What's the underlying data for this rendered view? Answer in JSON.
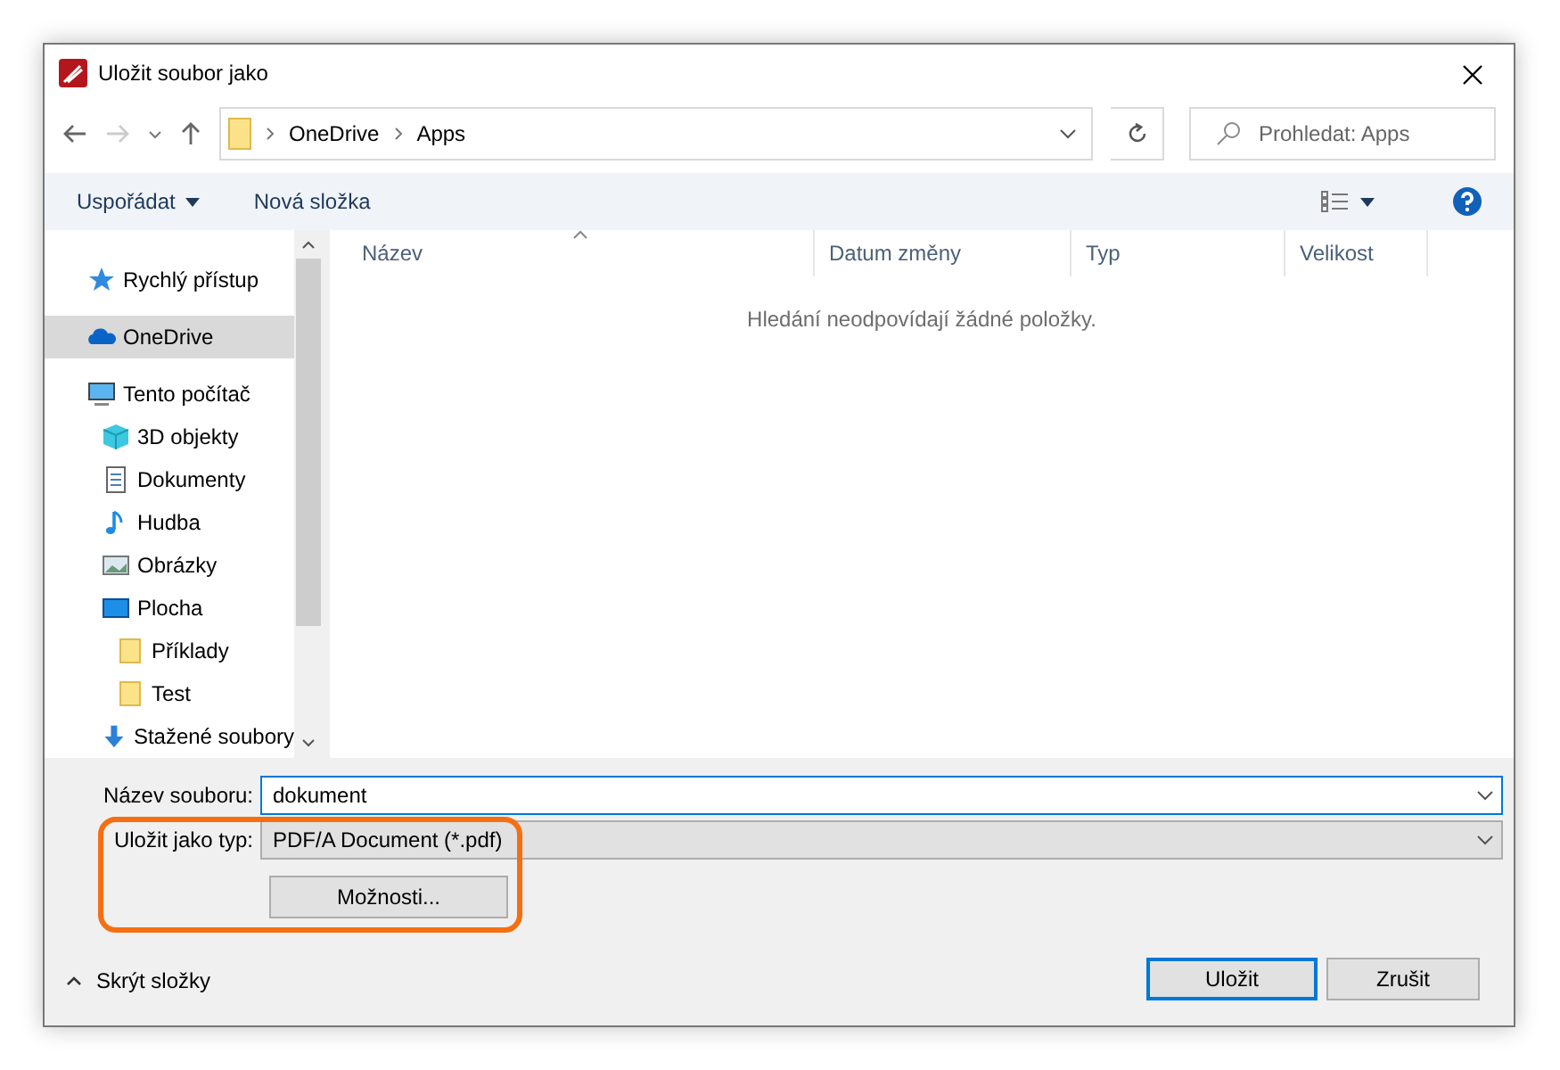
{
  "window": {
    "title": "Uložit soubor jako"
  },
  "address": {
    "path": [
      "OneDrive",
      "Apps"
    ],
    "search_placeholder": "Prohledat: Apps"
  },
  "toolbar": {
    "organize": "Uspořádat",
    "new_folder": "Nová složka"
  },
  "sidebar": {
    "items": [
      {
        "label": "Rychlý přístup",
        "kind": "star",
        "selected": false
      },
      {
        "label": "OneDrive",
        "kind": "cloud",
        "selected": true
      },
      {
        "label": "Tento počítač",
        "kind": "computer",
        "selected": false,
        "children": [
          {
            "label": "3D objekty",
            "kind": "cube",
            "selected": false
          },
          {
            "label": "Dokumenty",
            "kind": "document",
            "selected": false
          },
          {
            "label": "Hudba",
            "kind": "music",
            "selected": false
          },
          {
            "label": "Obrázky",
            "kind": "image",
            "selected": false
          },
          {
            "label": "Plocha",
            "kind": "desktop",
            "selected": false,
            "children": [
              {
                "label": "Příklady",
                "kind": "folder",
                "selected": false
              },
              {
                "label": "Test",
                "kind": "folder",
                "selected": false
              }
            ]
          },
          {
            "label": "Stažené soubory",
            "kind": "download",
            "selected": false
          }
        ]
      }
    ]
  },
  "file_list": {
    "columns": [
      "Název",
      "Datum změny",
      "Typ",
      "Velikost"
    ],
    "empty_message": "Hledání neodpovídají žádné položky."
  },
  "form": {
    "filename_label": "Název souboru:",
    "filename": "dokument",
    "type_label": "Uložit jako typ:",
    "type": "PDF/A Document (*.pdf)",
    "options_button": "Možnosti..."
  },
  "hide_folders": "Skrýt složky",
  "buttons": [
    {
      "label": "Uložit",
      "default": true
    },
    {
      "label": "Zrušit",
      "default": false
    }
  ]
}
